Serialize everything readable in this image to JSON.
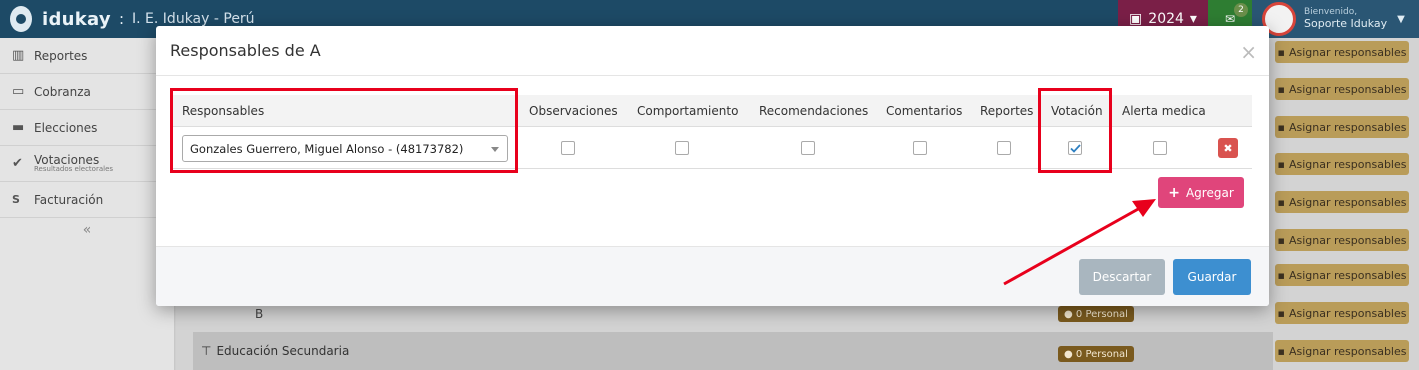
{
  "app": {
    "brand": "idukay",
    "separator": ":",
    "school": "I. E. Idukay - Perú",
    "year": "2024",
    "mail_count": "2",
    "greeting": "Bienvenido,",
    "user_name": "Soporte Idukay"
  },
  "sidebar": {
    "items": [
      {
        "label": "Reportes",
        "icon": "bar-chart-icon"
      },
      {
        "label": "Cobranza",
        "icon": "money-icon"
      },
      {
        "label": "Elecciones",
        "icon": "archive-icon"
      },
      {
        "label": "Votaciones",
        "sub": "Resultados electorales",
        "icon": "check-circle-icon"
      },
      {
        "label": "Facturación",
        "icon": "sae-logo-icon"
      }
    ]
  },
  "background": {
    "row_b_label": "B",
    "section_label": "Educación Secundaria",
    "personal_label": "0 Personal",
    "assign_label": "Asignar responsables"
  },
  "modal": {
    "title": "Responsables de A",
    "close_symbol": "×",
    "columns": [
      "Responsables",
      "Observaciones",
      "Comportamiento",
      "Recomendaciones",
      "Comentarios",
      "Reportes",
      "Votación",
      "Alerta medica"
    ],
    "row": {
      "responsable": "Gonzales Guerrero, Miguel Alonso - (48173782)",
      "checks": {
        "observaciones": false,
        "comportamiento": false,
        "recomendaciones": false,
        "comentarios": false,
        "reportes": false,
        "votacion": true,
        "alerta_medica": false
      }
    },
    "add_label": "Agregar",
    "discard_label": "Descartar",
    "save_label": "Guardar"
  },
  "colors": {
    "highlight": "#e8001c",
    "add_button": "#e0457b",
    "save_button": "#3d8fd0",
    "delete_button": "#d9534f"
  }
}
